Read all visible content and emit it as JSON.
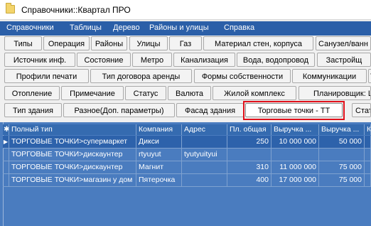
{
  "window": {
    "title": "Справочники::Квартал ПРО"
  },
  "menu": [
    "Справочники",
    "Таблицы",
    "Дерево",
    "Районы и улицы",
    "Справка"
  ],
  "tab_rows": [
    [
      "Типы",
      "Операция",
      "Районы",
      "Улицы",
      "Газ",
      "Материал стен, корпуса",
      "Санузел/ванн"
    ],
    [
      "Источник инф.",
      "Состояние",
      "Метро",
      "Канализация",
      "Вода, водопровод",
      "Застройщ"
    ],
    [
      "Профили печати",
      "Тип договора аренды",
      "Формы собственности",
      "Коммуникации",
      "Т"
    ],
    [
      "Отопление",
      "Примечание",
      "Статус",
      "Валюта",
      "Жилой комплекс",
      "Планировщик: L"
    ],
    [
      "Тип здания",
      "Разное(Доп. параметры)",
      "Фасад здания",
      "Торговые точки - ТТ",
      "Стат"
    ]
  ],
  "selected_tab": "Торговые точки - ТТ",
  "grid": {
    "columns": [
      "Полный тип",
      "Компания",
      "Адрес",
      "Пл. общая",
      "Выручка ...",
      "Выручка ...",
      "К"
    ],
    "rows": [
      [
        "ТОРГОВЫЕ ТОЧКИ>супермаркет",
        "Дикси",
        "",
        "250",
        "10 000 000",
        "50 000",
        ""
      ],
      [
        "ТОРГОВЫЕ ТОЧКИ>дискаунтер",
        "rtyuyut",
        "tyutyuityui",
        "",
        "",
        "",
        ""
      ],
      [
        "ТОРГОВЫЕ ТОЧКИ>дискаунтер",
        "Магнит",
        "",
        "310",
        "11 000 000",
        "75 000",
        ""
      ],
      [
        "ТОРГОВЫЕ ТОЧКИ>магазин у дом",
        "Пятерочка",
        "",
        "400",
        "17 000 000",
        "75 000",
        ""
      ]
    ],
    "selected_row": 0,
    "row_marker": "▶",
    "header_marker": "✱"
  },
  "colors": {
    "menu_bg": "#2b5fa8",
    "grid_bg": "#4a7cbf",
    "highlight": "#e0101a"
  }
}
